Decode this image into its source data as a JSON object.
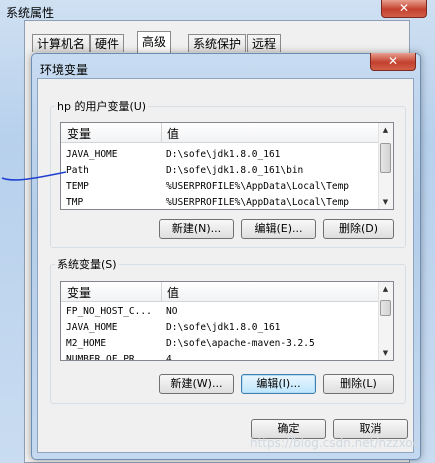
{
  "outer_window": {
    "title": "系统属性",
    "close_glyph": "✕",
    "tabs": [
      "计算机名",
      "硬件",
      "高级",
      "系统保护",
      "远程"
    ],
    "active_tab": "高级"
  },
  "dialog": {
    "title": "环境变量",
    "close_glyph": "✕",
    "user_vars": {
      "group_label": "hp 的用户变量(U)",
      "headers": [
        "变量",
        "值"
      ],
      "rows": [
        {
          "name": "JAVA_HOME",
          "value": "D:\\sofe\\jdk1.8.0_161"
        },
        {
          "name": "Path",
          "value": "D:\\sofe\\jdk1.8.0_161\\bin"
        },
        {
          "name": "TEMP",
          "value": "%USERPROFILE%\\AppData\\Local\\Temp"
        },
        {
          "name": "TMP",
          "value": "%USERPROFILE%\\AppData\\Local\\Temp"
        }
      ],
      "buttons": {
        "new": "新建(N)...",
        "edit": "编辑(E)...",
        "delete": "删除(D)"
      }
    },
    "system_vars": {
      "group_label": "系统变量(S)",
      "headers": [
        "变量",
        "值"
      ],
      "rows": [
        {
          "name": "FP_NO_HOST_C...",
          "value": "NO"
        },
        {
          "name": "JAVA_HOME",
          "value": "D:\\sofe\\jdk1.8.0_161"
        },
        {
          "name": "M2_HOME",
          "value": "D:\\sofe\\apache-maven-3.2.5"
        },
        {
          "name": "NUMBER_OF_PR...",
          "value": "4"
        }
      ],
      "buttons": {
        "new": "新建(W)...",
        "edit": "编辑(I)...",
        "delete": "删除(L)"
      }
    },
    "ok": "确定",
    "cancel": "取消"
  },
  "watermark": "https://blog.csdn.net/nzzxoc"
}
